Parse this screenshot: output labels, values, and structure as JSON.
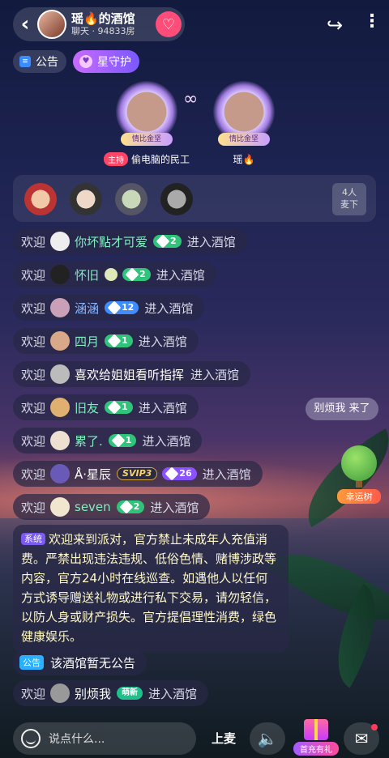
{
  "header": {
    "room_title": "瑶🔥的酒馆",
    "room_meta": "聊天 · 94833房",
    "back_icon": "chevron-left-icon",
    "fav_icon": "heart-plus-icon",
    "share_icon": "share-icon",
    "more_icon": "more-vertical-icon"
  },
  "chips": {
    "notice_label": "公告",
    "guard_label": "星守护"
  },
  "seats": [
    {
      "badge": "情比金坚",
      "tag": "主持",
      "name": "偷电脑的民工"
    },
    {
      "badge": "情比金坚",
      "tag": "",
      "name": "瑶🔥"
    }
  ],
  "queue": {
    "count_line1": "4人",
    "count_line2": "麦下"
  },
  "welcome_word": "欢迎",
  "enter_word": "进入酒馆",
  "messages": [
    {
      "name": "你坏點才可爱",
      "level": "2",
      "level_style": "green"
    },
    {
      "name": "怀旧",
      "level": "2",
      "level_style": "green",
      "ball": true
    },
    {
      "name": "涵涵",
      "level": "12",
      "level_style": "blue",
      "name_color": "#8fb8ff"
    },
    {
      "name": "四月",
      "level": "1",
      "level_style": "green"
    },
    {
      "name": "喜欢给姐姐看听指挥",
      "level": "",
      "level_style": "",
      "name_color": "#ffffff"
    },
    {
      "name": "旧友",
      "level": "1",
      "level_style": "green"
    },
    {
      "name": "累了.",
      "level": "1",
      "level_style": "green"
    },
    {
      "name": "Å·星辰",
      "level": "26",
      "level_style": "purple",
      "svip": "SVIP3",
      "name_color": "#ffffff"
    },
    {
      "name": "seven",
      "level": "2",
      "level_style": "green"
    }
  ],
  "system": {
    "tag": "系统",
    "text": "欢迎来到派对，官方禁止未成年人充值消费。严禁出现违法违规、低俗色情、赌博涉政等内容，官方24小时在线巡查。如遇他人以任何方式诱导赠送礼物或进行私下交易，请勿轻信，以防人身或财产损失。官方提倡理性消费，绿色健康娱乐。"
  },
  "announcement": {
    "tag": "公告",
    "text": "该酒馆暂无公告"
  },
  "last_welcome": {
    "name": "别烦我",
    "badge": "萌新"
  },
  "danmu": "别烦我 来了",
  "lucky_tree": "幸运树",
  "bottom": {
    "input_placeholder": "说点什么...",
    "mic_label": "上麦",
    "recharge_label": "首充有礼",
    "emoji_icon": "emoji-icon",
    "sound_icon": "speaker-icon",
    "mail_icon": "mail-icon"
  }
}
